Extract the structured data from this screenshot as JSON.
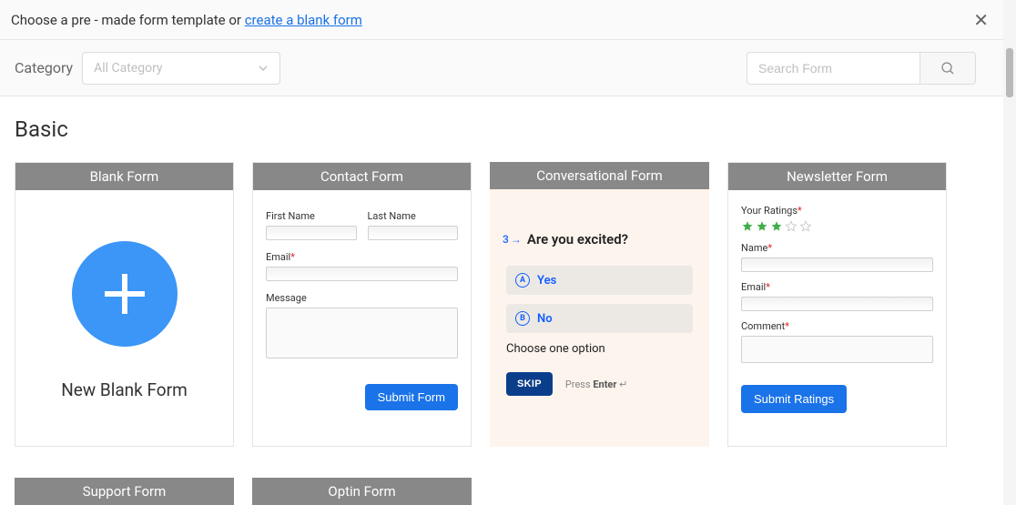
{
  "header": {
    "prefix": "Choose a pre - made form template or ",
    "link": "create a blank form"
  },
  "filter": {
    "category_label": "Category",
    "category_value": "All Category",
    "search_placeholder": "Search Form"
  },
  "section_title": "Basic",
  "cards": {
    "blank": {
      "title": "Blank Form",
      "cta": "New Blank Form"
    },
    "contact": {
      "title": "Contact Form",
      "first_name": "First Name",
      "last_name": "Last Name",
      "email": "Email",
      "message": "Message",
      "submit": "Submit Form"
    },
    "conv": {
      "title": "Conversational Form",
      "qnum": "3",
      "question": "Are you excited?",
      "opt_a_badge": "A",
      "opt_a": "Yes",
      "opt_b_badge": "B",
      "opt_b": "No",
      "helper": "Choose one option",
      "skip": "SKIP",
      "press": "Press ",
      "enter": "Enter",
      "arrow": " ↵"
    },
    "newsletter": {
      "title": "Newsletter Form",
      "ratings_label": "Your Ratings",
      "name": "Name",
      "email": "Email",
      "comment": "Comment",
      "submit": "Submit Ratings"
    },
    "support": {
      "title": "Support Form"
    },
    "optin": {
      "title": "Optin Form"
    }
  }
}
